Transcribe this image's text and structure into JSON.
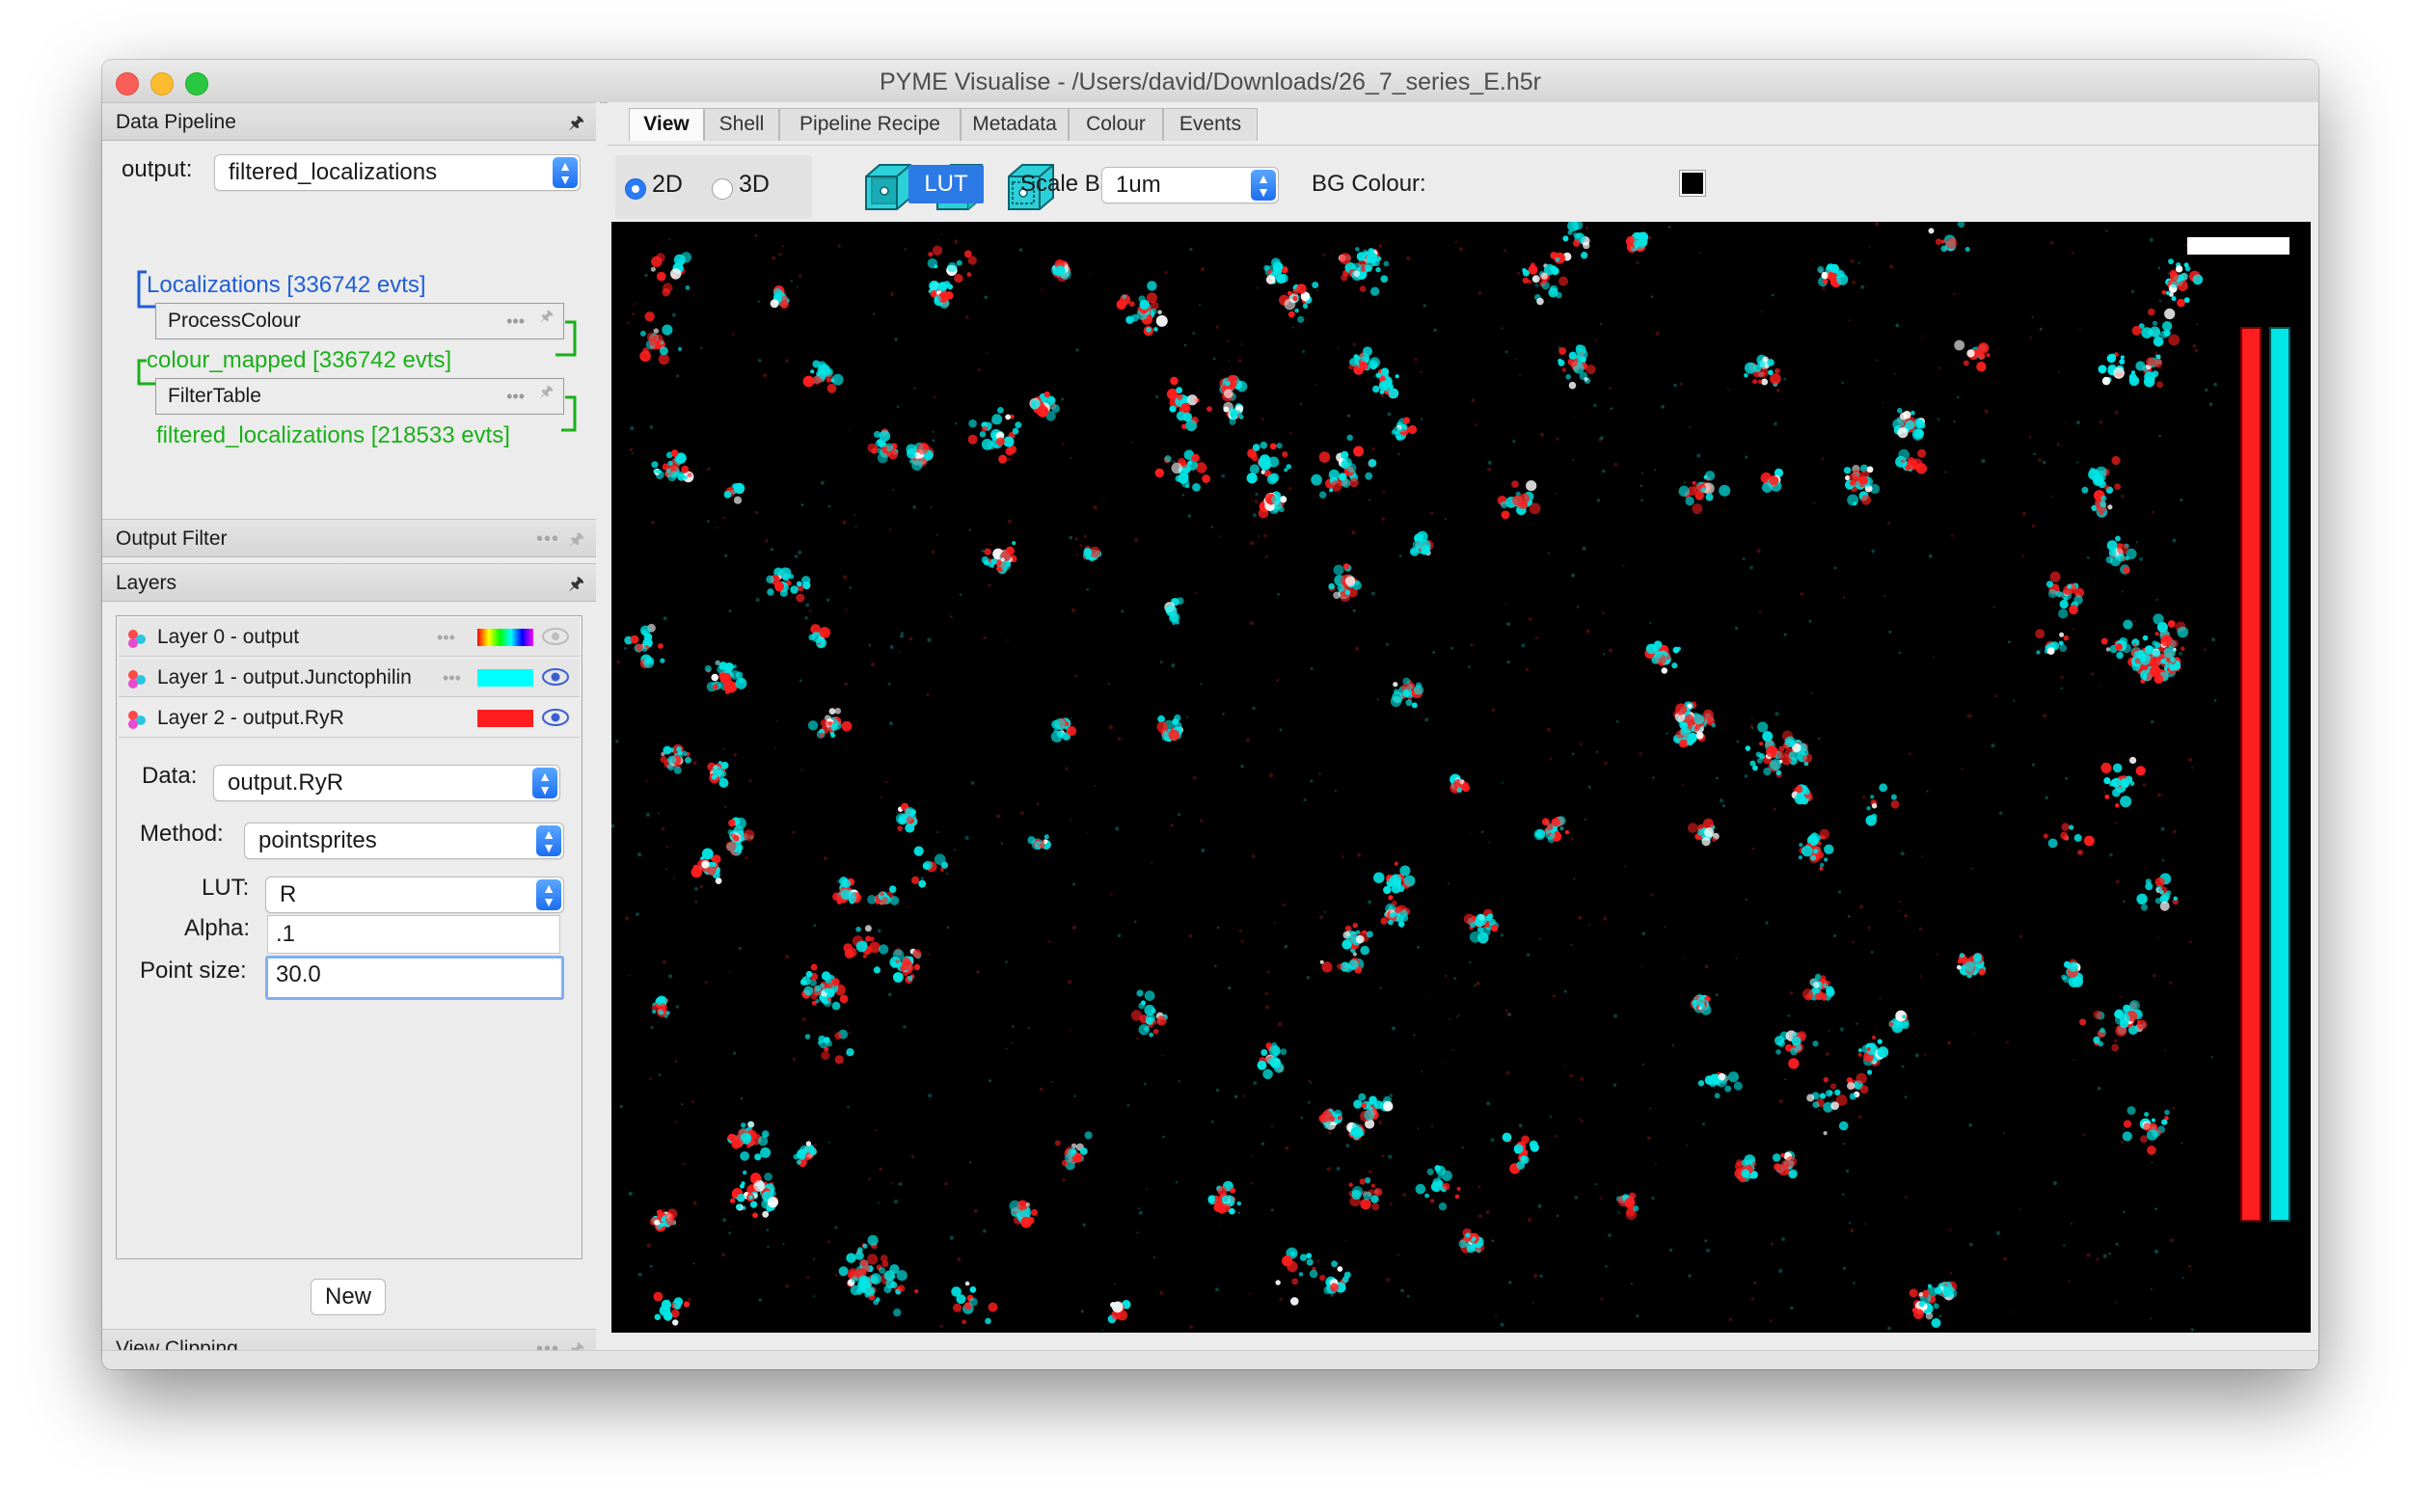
{
  "window": {
    "title": "PYME Visualise - /Users/david/Downloads/26_7_series_E.h5r"
  },
  "data_pipeline": {
    "header": "Data Pipeline",
    "output_label": "output:",
    "output_value": "filtered_localizations",
    "localizations": "Localizations [336742 evts]",
    "module1": "ProcessColour",
    "colour_mapped": "colour_mapped [336742 evts]",
    "module2": "FilterTable",
    "filtered": "filtered_localizations [218533 evts]"
  },
  "output_filter": {
    "header": "Output Filter"
  },
  "layers": {
    "header": "Layers",
    "items": [
      {
        "label": "Layer 0 - output"
      },
      {
        "label": "Layer 1 - output.Junctophilin",
        "color": "#00ffff"
      },
      {
        "label": "Layer 2 - output.RyR",
        "color": "#ff1e1e"
      }
    ],
    "data_label": "Data:",
    "data_value": "output.RyR",
    "method_label": "Method:",
    "method_value": "pointsprites",
    "lut_label": "LUT:",
    "lut_value": "R",
    "alpha_label": "Alpha:",
    "alpha_value": ".1",
    "point_size_label": "Point size:",
    "point_size_value": "30.0",
    "new_button": "New"
  },
  "view_clipping": {
    "header": "View Clipping"
  },
  "tabs": [
    "View",
    "Shell",
    "Pipeline Recipe",
    "Metadata",
    "Colour",
    "Events"
  ],
  "toolbar": {
    "radio_2d": "2D",
    "radio_3d": "3D",
    "lut_button": "LUT",
    "scale_bar_label": "Scale Bar:",
    "scale_bar_value": "1um",
    "bg_colour_label": "BG Colour:"
  },
  "colors": {
    "accent": "#2b7ae6",
    "pipeline_blue": "#1f5ed6",
    "pipeline_green": "#19b019",
    "cyan_channel": "#00e5e5",
    "red_channel": "#ff1e1e"
  }
}
